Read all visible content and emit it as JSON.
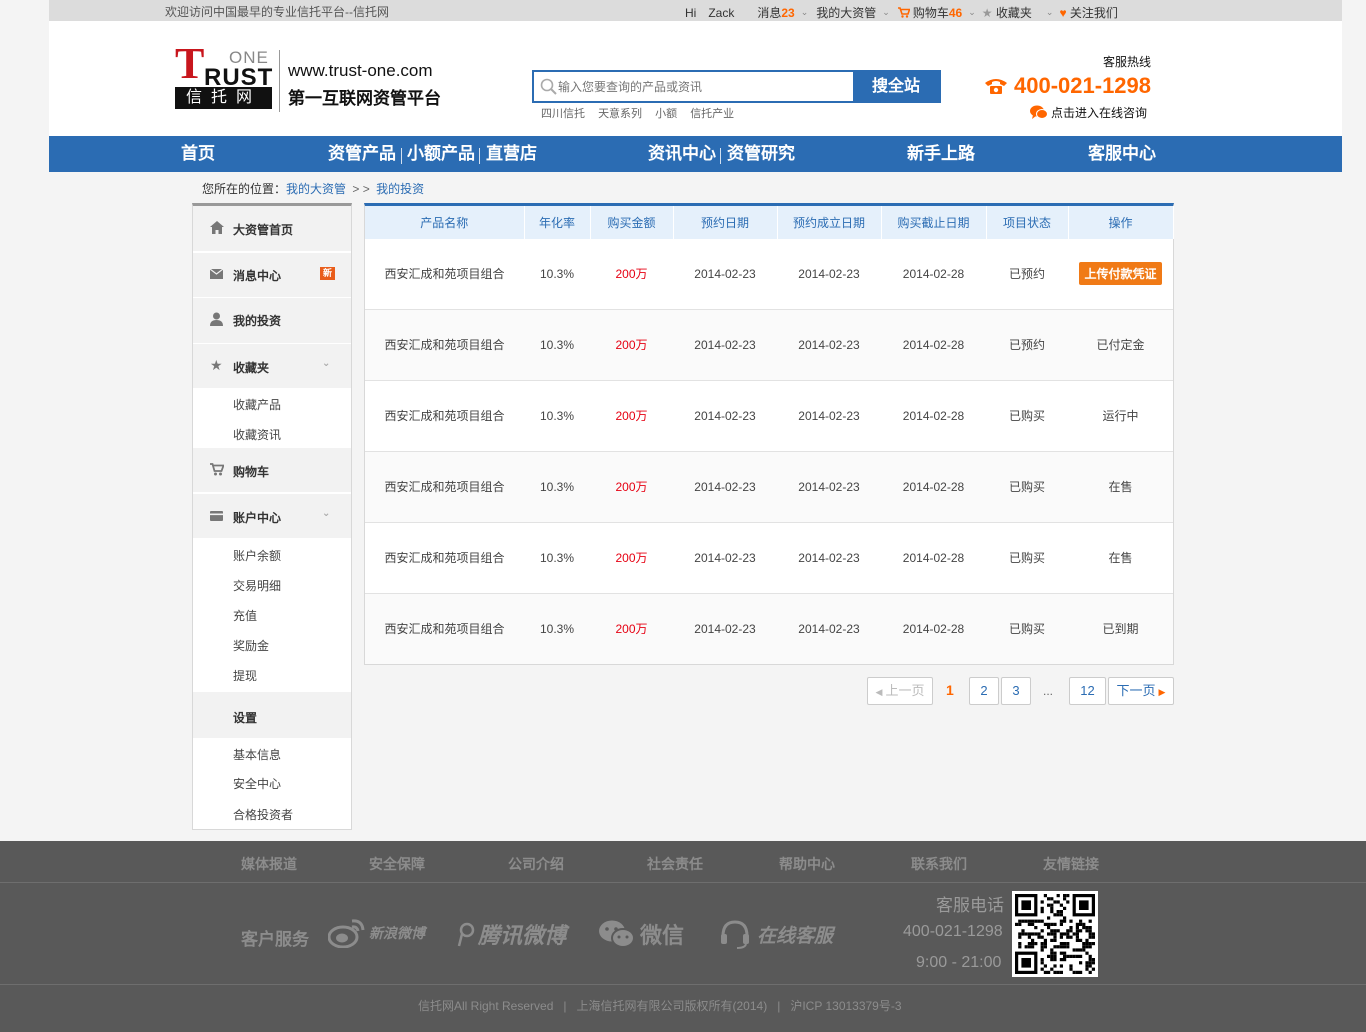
{
  "topbar": {
    "welcome": "欢迎访问中国最早的专业信托平台--信托网",
    "greeting": "Hi",
    "user": "Zack",
    "messages_label": "消息",
    "messages_count": "23",
    "my_asset": "我的大资管",
    "cart_label": "购物车",
    "cart_count": "46",
    "favorites": "收藏夹",
    "follow": "关注我们"
  },
  "header": {
    "logo_one": "ONE",
    "logo_t": "T",
    "logo_rust": "RUST",
    "logo_cn": "信托网",
    "url": "www.trust-one.com",
    "slogan": "第一互联网资管平台",
    "search_placeholder": "输入您要查询的产品或资讯",
    "search_button": "搜全站",
    "hot_words": [
      "四川信托",
      "天意系列",
      "小额",
      "信托产业"
    ],
    "hotline_label": "客服热线",
    "hotline": "400-021-1298",
    "online_consult": "点击进入在线咨询"
  },
  "nav": {
    "home": "首页",
    "asset_products": "资管产品",
    "small_products": "小额产品",
    "direct_store": "直营店",
    "news": "资讯中心",
    "research": "资管研究",
    "newbie": "新手上路",
    "service": "客服中心"
  },
  "breadcrumb": {
    "prefix": "您所在的位置：",
    "level1": "我的大资管",
    "sep": "> >",
    "level2": "我的投资"
  },
  "sidebar": {
    "home": "大资管首页",
    "messages": "消息中心",
    "new_badge": "新",
    "investments": "我的投资",
    "favorites": "收藏夹",
    "fav_products": "收藏产品",
    "fav_news": "收藏资讯",
    "cart": "购物车",
    "account": "账户中心",
    "balance": "账户余额",
    "transactions": "交易明细",
    "recharge": "充值",
    "bonus": "奖励金",
    "withdraw": "提现",
    "settings": "设置",
    "basic_info": "基本信息",
    "security": "安全中心",
    "qualified": "合格投资者"
  },
  "table": {
    "headers": [
      "产品名称",
      "年化率",
      "购买金额",
      "预约日期",
      "预约成立日期",
      "购买截止日期",
      "项目状态",
      "操作"
    ],
    "rows": [
      {
        "name": "西安汇成和苑项目组合",
        "rate": "10.3%",
        "amount": "200万",
        "reserve": "2014-02-23",
        "established": "2014-02-23",
        "deadline": "2014-02-28",
        "status": "已预约",
        "action": "上传付款凭证"
      },
      {
        "name": "西安汇成和苑项目组合",
        "rate": "10.3%",
        "amount": "200万",
        "reserve": "2014-02-23",
        "established": "2014-02-23",
        "deadline": "2014-02-28",
        "status": "已预约",
        "action": "已付定金"
      },
      {
        "name": "西安汇成和苑项目组合",
        "rate": "10.3%",
        "amount": "200万",
        "reserve": "2014-02-23",
        "established": "2014-02-23",
        "deadline": "2014-02-28",
        "status": "已购买",
        "action": "运行中"
      },
      {
        "name": "西安汇成和苑项目组合",
        "rate": "10.3%",
        "amount": "200万",
        "reserve": "2014-02-23",
        "established": "2014-02-23",
        "deadline": "2014-02-28",
        "status": "已购买",
        "action": "在售"
      },
      {
        "name": "西安汇成和苑项目组合",
        "rate": "10.3%",
        "amount": "200万",
        "reserve": "2014-02-23",
        "established": "2014-02-23",
        "deadline": "2014-02-28",
        "status": "已购买",
        "action": "在售"
      },
      {
        "name": "西安汇成和苑项目组合",
        "rate": "10.3%",
        "amount": "200万",
        "reserve": "2014-02-23",
        "established": "2014-02-23",
        "deadline": "2014-02-28",
        "status": "已购买",
        "action": "已到期"
      }
    ]
  },
  "pager": {
    "prev": "上一页",
    "current": "1",
    "p2": "2",
    "p3": "3",
    "dots": "...",
    "last": "12",
    "next": "下一页"
  },
  "footer": {
    "links": [
      "媒体报道",
      "安全保障",
      "公司介绍",
      "社会责任",
      "帮助中心",
      "联系我们",
      "友情链接"
    ],
    "customer_service": "客户服务",
    "weibo": "新浪微博",
    "tencent": "腾讯微博",
    "wechat": "微信",
    "online": "在线客服",
    "tel_label": "客服电话",
    "tel": "400-021-1298",
    "hours": "9:00 - 21:00",
    "copyright1": "信托网All Right Reserved",
    "copyright2": "上海信托网有限公司版权所有(2014)",
    "icp": "沪ICP 13013379号-3"
  },
  "colors": {
    "brand_blue": "#2b6cb3",
    "accent_orange": "#ff6600",
    "amount_red": "#e60012",
    "logo_red": "#c8161d"
  }
}
